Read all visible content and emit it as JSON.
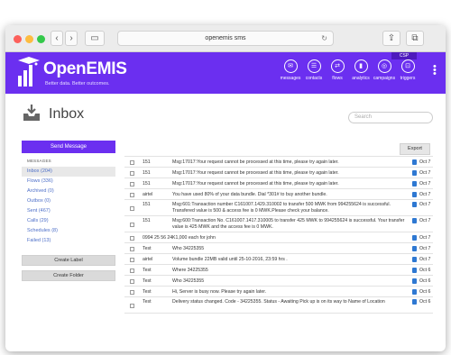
{
  "browser": {
    "url": "openemis sms"
  },
  "app": {
    "logo_title": "OpenEMIS",
    "logo_tagline": "Better data. Better outcomes.",
    "csp_label": "CSP",
    "nav": [
      {
        "label": "messages",
        "icon": "messages-icon",
        "glyph": "✉"
      },
      {
        "label": "contacts",
        "icon": "contacts-icon",
        "glyph": "☰"
      },
      {
        "label": "flows",
        "icon": "flows-icon",
        "glyph": "⇄"
      },
      {
        "label": "analytics",
        "icon": "analytics-icon",
        "glyph": "▮"
      },
      {
        "label": "campaigns",
        "icon": "campaigns-icon",
        "glyph": "◎"
      },
      {
        "label": "triggers",
        "icon": "triggers-icon",
        "glyph": "⊡"
      }
    ]
  },
  "page": {
    "title": "Inbox",
    "search_placeholder": "Search"
  },
  "sidebar": {
    "send_label": "Send Message",
    "section_title": "MESSAGES",
    "folders": [
      {
        "label": "Inbox (204)",
        "active": true
      },
      {
        "label": "Flows (336)"
      },
      {
        "label": "Archived (0)"
      },
      {
        "label": "Outbox (0)"
      },
      {
        "label": "Sent (467)"
      },
      {
        "label": "Calls (29)"
      },
      {
        "label": "Schedules (8)"
      },
      {
        "label": "Failed (13)"
      }
    ],
    "create_label": "Create Label",
    "create_folder": "Create Folder"
  },
  "toolbar": {
    "export_label": "Export"
  },
  "messages": [
    {
      "from": "151",
      "text": "Msg:17017:Your request cannot be processed at this time, please try again later.",
      "date": "Oct 7"
    },
    {
      "from": "151",
      "text": "Msg:17017:Your request cannot be processed at this time, please try again later.",
      "date": "Oct 7"
    },
    {
      "from": "151",
      "text": "Msg:17017:Your request cannot be processed at this time, please try again later.",
      "date": "Oct 7"
    },
    {
      "from": "airtel",
      "text": "You have used 80% of your data bundle. Dial *301# to buy another bundle.",
      "date": "Oct 7"
    },
    {
      "from": "151",
      "text": "Msg:601:Transaction number C161007.1429.310002 to transfer 500 MWK from 994255624 is successful. Transfered value is 500 & access fee is 0 MWK.Please check your balance.",
      "date": "Oct 7"
    },
    {
      "from": "151",
      "text": "Msg:600:Transaction No. C161007.1417.310005 to transfer 425 MWK to 994255624 is successful. Your transfer value is 425 MWK and the access fee is 0 MWK.",
      "date": "Oct 7"
    },
    {
      "from": "0994 25 56 24",
      "text": "K1,000 each for john",
      "date": "Oct 7"
    },
    {
      "from": "Test",
      "text": "Who 34225355",
      "date": "Oct 7"
    },
    {
      "from": "airtel",
      "text": "Volume bundle 22MB valid until 25-10-2016, 23:59 hrs .",
      "date": "Oct 7"
    },
    {
      "from": "Test",
      "text": "Where 34225355",
      "date": "Oct 6"
    },
    {
      "from": "Test",
      "text": "Who 34225355",
      "date": "Oct 6"
    },
    {
      "from": "Test",
      "text": "Hi, Server is busy now. Please try again later.",
      "date": "Oct 6"
    },
    {
      "from": "Test",
      "text": "Delivery status changed. Code - 34225355. Status - Awaiting Pick up is on its way to Name of Location",
      "date": "Oct 6"
    }
  ],
  "colors": {
    "brand": "#6b2ff0",
    "link": "#4c6ec8",
    "flag": "#2e78d2"
  }
}
